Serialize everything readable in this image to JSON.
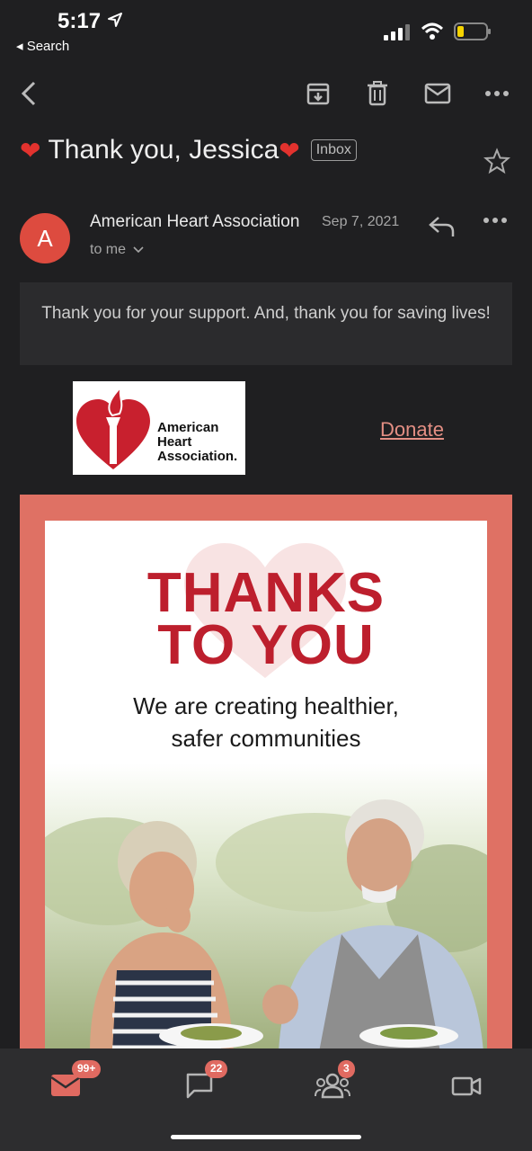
{
  "status_bar": {
    "time": "5:17",
    "back_app": "◂ Search"
  },
  "email": {
    "subject": "Thank you, Jessica",
    "label": "Inbox",
    "sender": "American Heart Association",
    "date": "Sep 7, 2021",
    "recipient": "to me",
    "avatar_letter": "A",
    "preheader": "Thank you for your support. And, thank you for saving lives!",
    "logo_text": [
      "American",
      "Heart",
      "Association."
    ],
    "donate_link": "Donate",
    "hero": {
      "title_line1": "THANKS",
      "title_line2": "TO YOU",
      "subtitle_line1": "We are creating healthier,",
      "subtitle_line2": "safer communities"
    }
  },
  "bottom_nav": {
    "mail_badge": "99+",
    "chat_badge": "22",
    "spaces_badge": "3"
  },
  "colors": {
    "accent": "#e06a61",
    "brand_red": "#bd1f2d",
    "avatar": "#dd4b3f",
    "background": "#1f1f21"
  }
}
